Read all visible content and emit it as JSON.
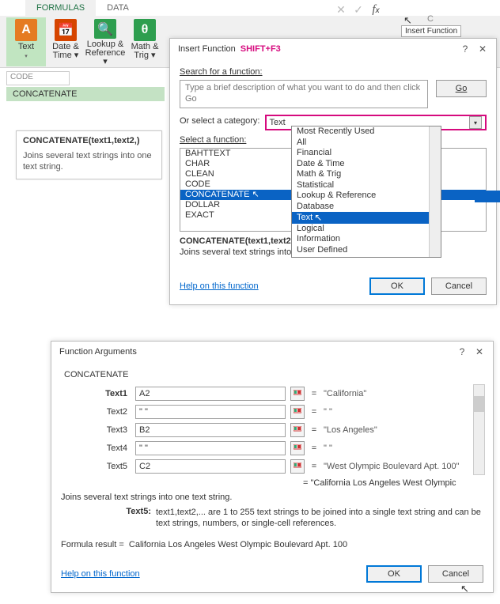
{
  "ribbon": {
    "tabs": [
      "FORMULAS",
      "DATA"
    ],
    "buttons": [
      {
        "label": "Text",
        "sub": "▾",
        "bg": "#e57b22",
        "glyph": "A"
      },
      {
        "label": "Date &",
        "sub": "Time ▾",
        "bg": "#d64500",
        "glyph": "📅"
      },
      {
        "label": "Lookup &",
        "sub": "Reference ▾",
        "bg": "#2e9e4f",
        "glyph": "🔍"
      },
      {
        "label": "Math &",
        "sub": "Trig ▾",
        "bg": "#2e9e4f",
        "glyph": "θ"
      }
    ]
  },
  "namebox": "CODE",
  "dropdown_preview": "CONCATENATE",
  "fn_tooltip": {
    "sig": "CONCATENATE(text1,text2,)",
    "desc": "Joins several text strings into one text string."
  },
  "formula_bar_tooltip": "Insert Function",
  "cell_letter": "C",
  "insert_dlg": {
    "title": "Insert Function",
    "shortcut": "SHIFT+F3",
    "search_label": "Search for a function:",
    "search_placeholder": "Type a brief description of what you want to do and then click Go",
    "go": "Go",
    "cat_label": "Or select a category:",
    "cat_value": "Text",
    "sel_label": "Select a function:",
    "functions": [
      "BAHTTEXT",
      "CHAR",
      "CLEAN",
      "CODE",
      "CONCATENATE",
      "DOLLAR",
      "EXACT"
    ],
    "sel_index": 4,
    "sig": "CONCATENATE(text1,text2,...)",
    "desc": "Joins several text strings into one text string.",
    "help": "Help on this function",
    "ok": "OK",
    "cancel": "Cancel",
    "categories": [
      "Most Recently Used",
      "All",
      "Financial",
      "Date & Time",
      "Math & Trig",
      "Statistical",
      "Lookup & Reference",
      "Database",
      "Text",
      "Logical",
      "Information",
      "User Defined"
    ],
    "cat_sel_index": 8
  },
  "args_dlg": {
    "title": "Function Arguments",
    "fn": "CONCATENATE",
    "rows": [
      {
        "label": "Text1",
        "bold": true,
        "value": "A2",
        "result": "\"California\""
      },
      {
        "label": "Text2",
        "bold": false,
        "value": "\" \"",
        "result": "\" \""
      },
      {
        "label": "Text3",
        "bold": false,
        "value": "B2",
        "result": "\"Los Angeles\""
      },
      {
        "label": "Text4",
        "bold": false,
        "value": "\" \"",
        "result": "\" \""
      },
      {
        "label": "Text5",
        "bold": false,
        "value": "C2",
        "result": "\"West Olympic Boulevard Apt. 100\""
      }
    ],
    "combined": "\"California Los Angeles West Olympic",
    "desc": "Joins several text strings into one text string.",
    "detail_label": "Text5:",
    "detail_text": "text1,text2,... are 1 to 255 text strings to be joined into a single text string and can be text strings, numbers, or single-cell references.",
    "formula_label": "Formula result =",
    "formula_value": "California Los Angeles West Olympic Boulevard Apt. 100",
    "help": "Help on this function",
    "ok": "OK",
    "cancel": "Cancel"
  }
}
